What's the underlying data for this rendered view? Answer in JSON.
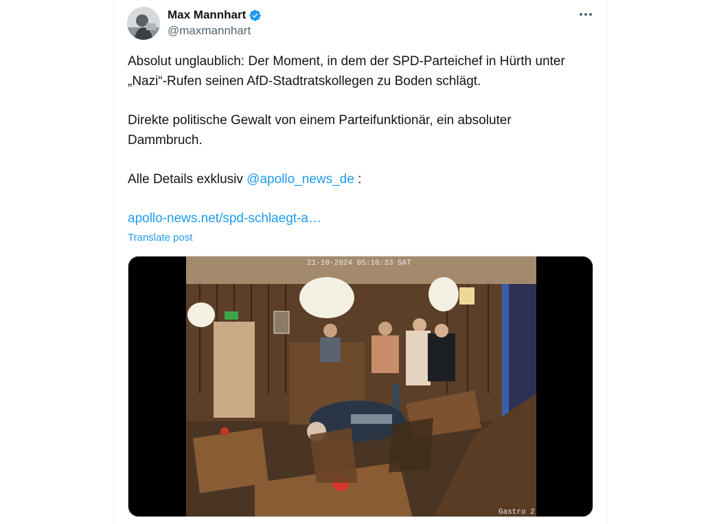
{
  "tweet": {
    "author": {
      "name": "Max Mannhart",
      "handle": "@maxmannhart",
      "verified": true,
      "badge_color": "#1d9bf0"
    },
    "body": {
      "p1": "Absolut unglaublich: Der Moment, in dem der SPD-Parteichef in Hürth unter „Nazi“-Rufen seinen AfD-Stadtratskollegen zu Boden schlägt.",
      "p2": "Direkte politische Gewalt von einem Parteifunktionär, ein absoluter Dammbruch.",
      "p3_prefix": "Alle Details exklusiv ",
      "p3_mention": "@apollo_news_de",
      "p3_suffix": " :",
      "link": "apollo-news.net/spd-schlaegt-a…"
    },
    "translate_label": "Translate post",
    "media": {
      "type": "surveillance camera still",
      "overlay_timestamp": "21-10-2024 05:16:33 SAT",
      "camera_label": "Gastro 2"
    }
  },
  "colors": {
    "link": "#1d9bf0",
    "text": "#0f1419",
    "secondary": "#536471"
  }
}
